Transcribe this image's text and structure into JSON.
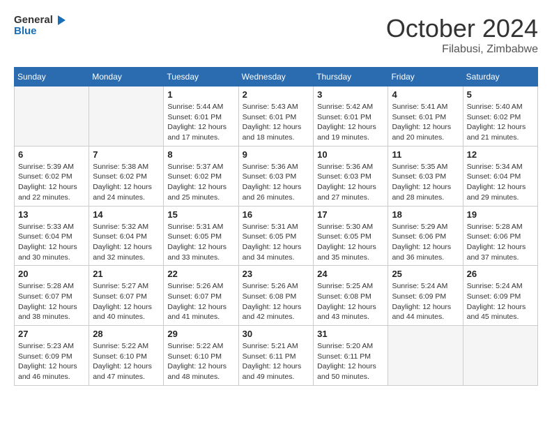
{
  "logo": {
    "text_general": "General",
    "text_blue": "Blue"
  },
  "header": {
    "month": "October 2024",
    "location": "Filabusi, Zimbabwe"
  },
  "days_of_week": [
    "Sunday",
    "Monday",
    "Tuesday",
    "Wednesday",
    "Thursday",
    "Friday",
    "Saturday"
  ],
  "weeks": [
    [
      {
        "day": "",
        "empty": true
      },
      {
        "day": "",
        "empty": true
      },
      {
        "day": "1",
        "sunrise": "5:44 AM",
        "sunset": "6:01 PM",
        "daylight": "12 hours and 17 minutes."
      },
      {
        "day": "2",
        "sunrise": "5:43 AM",
        "sunset": "6:01 PM",
        "daylight": "12 hours and 18 minutes."
      },
      {
        "day": "3",
        "sunrise": "5:42 AM",
        "sunset": "6:01 PM",
        "daylight": "12 hours and 19 minutes."
      },
      {
        "day": "4",
        "sunrise": "5:41 AM",
        "sunset": "6:01 PM",
        "daylight": "12 hours and 20 minutes."
      },
      {
        "day": "5",
        "sunrise": "5:40 AM",
        "sunset": "6:02 PM",
        "daylight": "12 hours and 21 minutes."
      }
    ],
    [
      {
        "day": "6",
        "sunrise": "5:39 AM",
        "sunset": "6:02 PM",
        "daylight": "12 hours and 22 minutes."
      },
      {
        "day": "7",
        "sunrise": "5:38 AM",
        "sunset": "6:02 PM",
        "daylight": "12 hours and 24 minutes."
      },
      {
        "day": "8",
        "sunrise": "5:37 AM",
        "sunset": "6:02 PM",
        "daylight": "12 hours and 25 minutes."
      },
      {
        "day": "9",
        "sunrise": "5:36 AM",
        "sunset": "6:03 PM",
        "daylight": "12 hours and 26 minutes."
      },
      {
        "day": "10",
        "sunrise": "5:36 AM",
        "sunset": "6:03 PM",
        "daylight": "12 hours and 27 minutes."
      },
      {
        "day": "11",
        "sunrise": "5:35 AM",
        "sunset": "6:03 PM",
        "daylight": "12 hours and 28 minutes."
      },
      {
        "day": "12",
        "sunrise": "5:34 AM",
        "sunset": "6:04 PM",
        "daylight": "12 hours and 29 minutes."
      }
    ],
    [
      {
        "day": "13",
        "sunrise": "5:33 AM",
        "sunset": "6:04 PM",
        "daylight": "12 hours and 30 minutes."
      },
      {
        "day": "14",
        "sunrise": "5:32 AM",
        "sunset": "6:04 PM",
        "daylight": "12 hours and 32 minutes."
      },
      {
        "day": "15",
        "sunrise": "5:31 AM",
        "sunset": "6:05 PM",
        "daylight": "12 hours and 33 minutes."
      },
      {
        "day": "16",
        "sunrise": "5:31 AM",
        "sunset": "6:05 PM",
        "daylight": "12 hours and 34 minutes."
      },
      {
        "day": "17",
        "sunrise": "5:30 AM",
        "sunset": "6:05 PM",
        "daylight": "12 hours and 35 minutes."
      },
      {
        "day": "18",
        "sunrise": "5:29 AM",
        "sunset": "6:06 PM",
        "daylight": "12 hours and 36 minutes."
      },
      {
        "day": "19",
        "sunrise": "5:28 AM",
        "sunset": "6:06 PM",
        "daylight": "12 hours and 37 minutes."
      }
    ],
    [
      {
        "day": "20",
        "sunrise": "5:28 AM",
        "sunset": "6:07 PM",
        "daylight": "12 hours and 38 minutes."
      },
      {
        "day": "21",
        "sunrise": "5:27 AM",
        "sunset": "6:07 PM",
        "daylight": "12 hours and 40 minutes."
      },
      {
        "day": "22",
        "sunrise": "5:26 AM",
        "sunset": "6:07 PM",
        "daylight": "12 hours and 41 minutes."
      },
      {
        "day": "23",
        "sunrise": "5:26 AM",
        "sunset": "6:08 PM",
        "daylight": "12 hours and 42 minutes."
      },
      {
        "day": "24",
        "sunrise": "5:25 AM",
        "sunset": "6:08 PM",
        "daylight": "12 hours and 43 minutes."
      },
      {
        "day": "25",
        "sunrise": "5:24 AM",
        "sunset": "6:09 PM",
        "daylight": "12 hours and 44 minutes."
      },
      {
        "day": "26",
        "sunrise": "5:24 AM",
        "sunset": "6:09 PM",
        "daylight": "12 hours and 45 minutes."
      }
    ],
    [
      {
        "day": "27",
        "sunrise": "5:23 AM",
        "sunset": "6:09 PM",
        "daylight": "12 hours and 46 minutes."
      },
      {
        "day": "28",
        "sunrise": "5:22 AM",
        "sunset": "6:10 PM",
        "daylight": "12 hours and 47 minutes."
      },
      {
        "day": "29",
        "sunrise": "5:22 AM",
        "sunset": "6:10 PM",
        "daylight": "12 hours and 48 minutes."
      },
      {
        "day": "30",
        "sunrise": "5:21 AM",
        "sunset": "6:11 PM",
        "daylight": "12 hours and 49 minutes."
      },
      {
        "day": "31",
        "sunrise": "5:20 AM",
        "sunset": "6:11 PM",
        "daylight": "12 hours and 50 minutes."
      },
      {
        "day": "",
        "empty": true
      },
      {
        "day": "",
        "empty": true
      }
    ]
  ],
  "labels": {
    "sunrise": "Sunrise:",
    "sunset": "Sunset:",
    "daylight": "Daylight:"
  }
}
